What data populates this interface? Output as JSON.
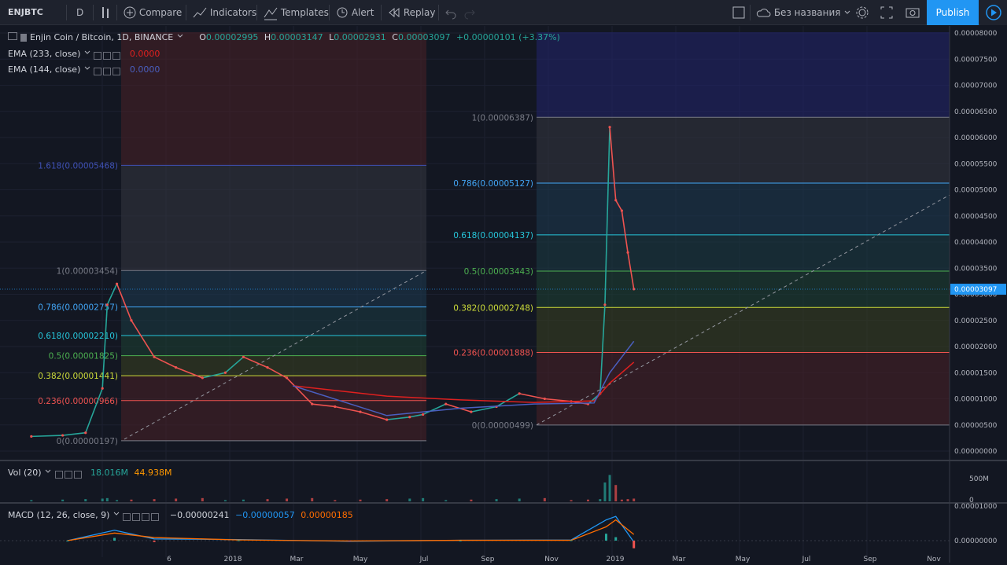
{
  "toolbar": {
    "symbol": "ENJBTC",
    "interval": "D",
    "compare": "Compare",
    "indicators": "Indicators",
    "templates": "Templates",
    "alert": "Alert",
    "replay": "Replay",
    "layout_name": "Без названия",
    "publish": "Publish"
  },
  "legend": {
    "title": "Enjin Coin / Bitcoin, 1D, BINANCE",
    "o_label": "O",
    "o_value": "0.00002995",
    "h_label": "H",
    "h_value": "0.00003147",
    "l_label": "L",
    "l_value": "0.00002931",
    "c_label": "C",
    "c_value": "0.00003097",
    "change": "+0.00000101 (+3.37%)",
    "ema233_label": "EMA (233, close)",
    "ema233_value": "0.0000",
    "ema144_label": "EMA (144, close)",
    "ema144_value": "0.0000",
    "vol_label": "Vol (20)",
    "vol_value1": "18.016M",
    "vol_value2": "44.938M",
    "macd_label": "MACD (12, 26, close, 9)",
    "macd_v1": "−0.00000241",
    "macd_v2": "−0.00000057",
    "macd_v3": "0.00000185"
  },
  "colors": {
    "up": "#26a69a",
    "down": "#ef5350",
    "ema233": "#e0201f",
    "ema144": "#4a5fc0",
    "bg": "#131722",
    "accent": "#2196f3"
  },
  "chart_data": {
    "type": "line",
    "title": "Enjin Coin / Bitcoin, 1D, BINANCE",
    "y_ticks": [
      "0.00008000",
      "0.00007500",
      "0.00007000",
      "0.00006500",
      "0.00006000",
      "0.00005500",
      "0.00005000",
      "0.00004500",
      "0.00004000",
      "0.00003500",
      "0.00003000",
      "0.00002500",
      "0.00002000",
      "0.00001500",
      "0.00001000",
      "0.00000500",
      "0.00000000"
    ],
    "ylim": [
      0,
      8e-05
    ],
    "x_ticks": [
      "6",
      "2018",
      "Mar",
      "May",
      "Jul",
      "Sep",
      "Nov",
      "2019",
      "Mar",
      "May",
      "Jul",
      "Sep",
      "Nov"
    ],
    "last_price_label": "0.00003097",
    "series": [
      {
        "name": "ENJBTC close",
        "x": [
          "2017-11-10",
          "2017-12-06",
          "2017-12-25",
          "2018-01-08",
          "2018-01-12",
          "2018-01-20",
          "2018-02-01",
          "2018-02-20",
          "2018-03-10",
          "2018-04-01",
          "2018-04-20",
          "2018-05-05",
          "2018-05-25",
          "2018-06-10",
          "2018-07-01",
          "2018-07-20",
          "2018-08-10",
          "2018-09-01",
          "2018-09-20",
          "2018-10-01",
          "2018-10-20",
          "2018-11-10",
          "2018-12-01",
          "2018-12-20",
          "2019-01-10",
          "2019-02-01",
          "2019-02-15",
          "2019-02-25",
          "2019-03-01",
          "2019-03-05",
          "2019-03-10",
          "2019-03-15",
          "2019-03-20",
          "2019-03-25"
        ],
        "y": [
          2.8e-06,
          3e-06,
          3.5e-06,
          1.2e-05,
          2.8e-05,
          3.2e-05,
          2.5e-05,
          1.8e-05,
          1.6e-05,
          1.4e-05,
          1.5e-05,
          1.8e-05,
          1.6e-05,
          1.4e-05,
          9e-06,
          8.5e-06,
          7.5e-06,
          6e-06,
          6.5e-06,
          7e-06,
          9e-06,
          7.5e-06,
          8.5e-06,
          1.1e-05,
          1e-05,
          9.5e-06,
          9e-06,
          1.1e-05,
          2.8e-05,
          6.2e-05,
          4.8e-05,
          4.6e-05,
          3.8e-05,
          3.1e-05
        ]
      },
      {
        "name": "EMA (233, close)",
        "x": [
          "2018-06-15",
          "2018-09-01",
          "2018-11-01",
          "2019-01-01",
          "2019-02-20",
          "2019-03-05",
          "2019-03-25"
        ],
        "y": [
          1.25e-05,
          1.05e-05,
          9.8e-06,
          9.3e-06,
          9.6e-06,
          1.3e-05,
          1.7e-05
        ]
      },
      {
        "name": "EMA (144, close)",
        "x": [
          "2018-06-15",
          "2018-09-01",
          "2018-11-01",
          "2019-01-01",
          "2019-02-20",
          "2019-03-05",
          "2019-03-25"
        ],
        "y": [
          1.25e-05,
          6.8e-06,
          8.2e-06,
          9e-06,
          9.2e-06,
          1.5e-05,
          2.1e-05
        ]
      }
    ],
    "fib_left": [
      {
        "label": "1.618(0.00005468)",
        "value": 5.468e-05,
        "color": "#3f51b5"
      },
      {
        "label": "1(0.00003454)",
        "value": 3.454e-05,
        "color": "#787b86"
      },
      {
        "label": "0.786(0.00002757)",
        "value": 2.757e-05,
        "color": "#42a5f5"
      },
      {
        "label": "0.618(0.00002210)",
        "value": 2.21e-05,
        "color": "#26c6da"
      },
      {
        "label": "0.5(0.00001825)",
        "value": 1.825e-05,
        "color": "#4caf50"
      },
      {
        "label": "0.382(0.00001441)",
        "value": 1.441e-05,
        "color": "#cddc39"
      },
      {
        "label": "0.236(0.00000966)",
        "value": 9.66e-06,
        "color": "#ef5350"
      },
      {
        "label": "0(0.00000197)",
        "value": 1.97e-06,
        "color": "#787b86"
      }
    ],
    "fib_right": [
      {
        "label": "1(0.00006387)",
        "value": 6.387e-05,
        "color": "#787b86"
      },
      {
        "label": "0.786(0.00005127)",
        "value": 5.127e-05,
        "color": "#42a5f5"
      },
      {
        "label": "0.618(0.00004137)",
        "value": 4.137e-05,
        "color": "#26c6da"
      },
      {
        "label": "0.5(0.00003443)",
        "value": 3.443e-05,
        "color": "#4caf50"
      },
      {
        "label": "0.382(0.00002748)",
        "value": 2.748e-05,
        "color": "#cddc39"
      },
      {
        "label": "0.236(0.00001888)",
        "value": 1.888e-05,
        "color": "#ef5350"
      },
      {
        "label": "0(0.00000499)",
        "value": 4.99e-06,
        "color": "#787b86"
      }
    ],
    "volume": {
      "axis_label": "500M",
      "y_ticks": [
        "500M",
        "0"
      ]
    },
    "macd": {
      "y_ticks": [
        "0.00001000",
        "0.00000000"
      ]
    }
  }
}
